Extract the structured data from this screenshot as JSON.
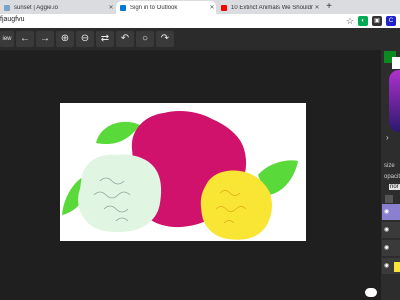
{
  "browser": {
    "tabs": [
      {
        "title": "sunset | Aggie.io",
        "favicon_color": "#7aa3c9",
        "active": false
      },
      {
        "title": "Sign in to Outlook",
        "favicon_color": "#0078d4",
        "active": true
      },
      {
        "title": "10 Extinct Animals We Shouldn'",
        "favicon_color": "#ff0000",
        "active": false
      }
    ],
    "new_tab": "+",
    "url_fragment": "fjaugfvu",
    "extension_icons": [
      "star-icon",
      "extension-icon",
      "ad-icon",
      "c-icon"
    ]
  },
  "toolbar": {
    "view_label": "iew",
    "buttons": [
      {
        "name": "back-arrow",
        "glyph": "←"
      },
      {
        "name": "forward-arrow",
        "glyph": "→"
      },
      {
        "name": "zoom-in",
        "glyph": "⊕"
      },
      {
        "name": "zoom-out",
        "glyph": "⊖"
      },
      {
        "name": "flip-horizontal",
        "glyph": "⇄"
      },
      {
        "name": "rotate-left",
        "glyph": "↶"
      },
      {
        "name": "reset-rotation",
        "glyph": "○"
      },
      {
        "name": "rotate-right",
        "glyph": "↷"
      }
    ]
  },
  "panel": {
    "primary_color": "#0a8a1f",
    "secondary_color": "#ffffff",
    "size_label": "size",
    "opacity_label": "opacit",
    "blend_value": "nor",
    "layer_eye": "👁"
  },
  "artwork": {
    "flowers": [
      {
        "name": "magenta-flower",
        "color": "#d1126d"
      },
      {
        "name": "white-flower",
        "color": "#e0f5e2"
      },
      {
        "name": "yellow-flower",
        "color": "#f9e533"
      }
    ],
    "leaf_color": "#5ad93a"
  },
  "colors": {
    "accent_layer": "#8a7fd1",
    "toolbar_bg": "#2b2b2b",
    "workspace_bg": "#1f1f1f"
  }
}
